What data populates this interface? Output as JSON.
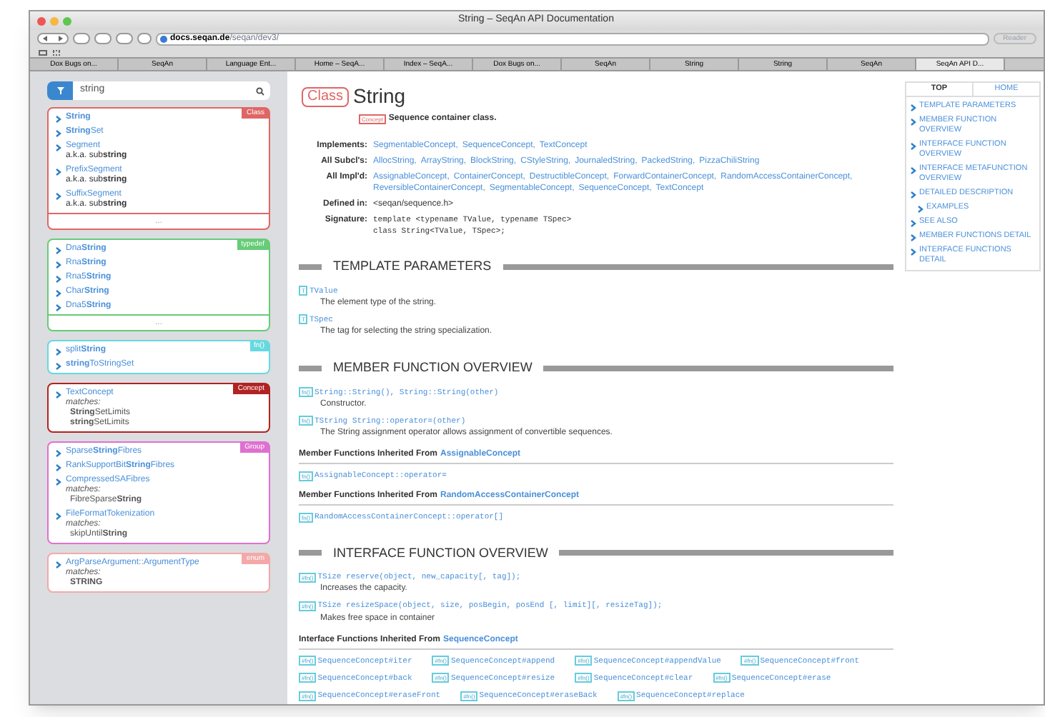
{
  "window": {
    "title": "String – SeqAn API Documentation"
  },
  "toolbar": {
    "url_host": "docs.seqan.de",
    "url_path": "/seqan/dev3/",
    "reader": "Reader"
  },
  "tabs": [
    {
      "label": "Dox Bugs on...",
      "selected": false
    },
    {
      "label": "SeqAn",
      "selected": false
    },
    {
      "label": "Language Ent...",
      "selected": false
    },
    {
      "label": "Home – SeqA...",
      "selected": false
    },
    {
      "label": "Index – SeqA...",
      "selected": false
    },
    {
      "label": "Dox Bugs on...",
      "selected": false
    },
    {
      "label": "SeqAn",
      "selected": false
    },
    {
      "label": "String",
      "selected": false
    },
    {
      "label": "String",
      "selected": false
    },
    {
      "label": "SeqAn",
      "selected": false
    },
    {
      "label": "SeqAn API D...",
      "selected": true
    }
  ],
  "sidebar": {
    "search": {
      "value": "string"
    },
    "groups": [
      {
        "tag": "Class",
        "color": "#e06666",
        "items": [
          {
            "name": "**String**"
          },
          {
            "name": "**String**Set"
          },
          {
            "name": "Segment",
            "details": [
              {
                "kind": "aka",
                "text": "a.k.a. sub**string**"
              }
            ]
          },
          {
            "name": "PrefixSegment",
            "details": [
              {
                "kind": "aka",
                "text": "a.k.a. sub**string**"
              }
            ]
          },
          {
            "name": "SuffixSegment",
            "details": [
              {
                "kind": "aka",
                "text": "a.k.a. sub**string**"
              }
            ]
          }
        ],
        "more": "..."
      },
      {
        "tag": "typedef",
        "color": "#66cc77",
        "items": [
          {
            "name": "Dna**String**"
          },
          {
            "name": "Rna**String**"
          },
          {
            "name": "Rna5**String**"
          },
          {
            "name": "Char**String**"
          },
          {
            "name": "Dna5**String**"
          }
        ],
        "more": "..."
      },
      {
        "tag": "fn()",
        "color": "#66d9e0",
        "items": [
          {
            "name": "split**String**"
          },
          {
            "name": "**string**ToStringSet"
          }
        ]
      },
      {
        "tag": "Concept",
        "color": "#b22222",
        "items": [
          {
            "name": "TextConcept",
            "details": [
              {
                "kind": "label",
                "text": "matches:"
              },
              {
                "kind": "match",
                "text": "**String**SetLimits"
              },
              {
                "kind": "match",
                "text": "**string**SetLimits"
              }
            ]
          }
        ]
      },
      {
        "tag": "Group",
        "color": "#e070d0",
        "items": [
          {
            "name": "Sparse**String**Fibres"
          },
          {
            "name": "RankSupportBit**String**Fibres"
          },
          {
            "name": "CompressedSAFibres",
            "details": [
              {
                "kind": "label",
                "text": "matches:"
              },
              {
                "kind": "match",
                "text": "FibreSparse**String**"
              }
            ]
          },
          {
            "name": "FileFormatTokenization",
            "details": [
              {
                "kind": "label",
                "text": "matches:"
              },
              {
                "kind": "match",
                "text": "skipUntil**String**"
              }
            ]
          }
        ]
      },
      {
        "tag": "enum",
        "color": "#f4a8a8",
        "items": [
          {
            "name": "ArgParseArgument::ArgumentType",
            "details": [
              {
                "kind": "label",
                "text": "matches:"
              },
              {
                "kind": "match",
                "text": "**STRING**"
              }
            ]
          }
        ]
      }
    ]
  },
  "main": {
    "kind_badge": "Class",
    "title": "String",
    "concept_badge": "Concept",
    "brief": "Sequence container class.",
    "info": [
      {
        "label": "Implements:",
        "kind": "links",
        "values": [
          "SegmentableConcept,",
          "SequenceConcept,",
          "TextConcept"
        ]
      },
      {
        "label": "All Subcl's:",
        "kind": "links",
        "values": [
          "AllocString,",
          "ArrayString,",
          "BlockString,",
          "CStyleString,",
          "JournaledString,",
          "PackedString,",
          "PizzaChiliString"
        ]
      },
      {
        "label": "All Impl'd:",
        "kind": "links",
        "values": [
          "AssignableConcept,",
          "ContainerConcept,",
          "DestructibleConcept,",
          "ForwardContainerConcept,",
          "RandomAccessContainerConcept,",
          "ReversibleContainerConcept,",
          "SegmentableConcept,",
          "SequenceConcept,",
          "TextConcept"
        ]
      },
      {
        "label": "Defined in:",
        "kind": "text",
        "values": [
          "<seqan/sequence.h>"
        ]
      },
      {
        "label": "Signature:",
        "kind": "code",
        "values": [
          "template <typename TValue, typename TSpec>",
          "class String<TValue, TSpec>;"
        ]
      }
    ],
    "sections": [
      {
        "title": "TEMPLATE PARAMETERS",
        "entries": [
          {
            "badge": "T",
            "name": "TValue",
            "desc": "The element type of the string."
          },
          {
            "badge": "T",
            "name": "TSpec",
            "desc": "The tag for selecting the string specialization."
          }
        ]
      },
      {
        "title": "MEMBER FUNCTION OVERVIEW",
        "entries": [
          {
            "badge": "fn()",
            "name": "String::String(), String::String(other)",
            "desc": "Constructor."
          },
          {
            "badge": "fn()",
            "name": "TString String::operator=(other)",
            "desc": "The String assignment operator allows assignment of convertible sequences."
          }
        ],
        "inherited": [
          {
            "label": "Member Functions Inherited From",
            "link": "AssignableConcept",
            "items": [
              {
                "badge": "fn()",
                "name": "AssignableConcept::operator="
              }
            ]
          },
          {
            "label": "Member Functions Inherited From",
            "link": "RandomAccessContainerConcept",
            "items": [
              {
                "badge": "fn()",
                "name": "RandomAccessContainerConcept::operator[]"
              }
            ]
          }
        ]
      },
      {
        "title": "INTERFACE FUNCTION OVERVIEW",
        "entries": [
          {
            "badge": "#fn()",
            "name": "TSize reserve(object, new_capacity[, tag]);",
            "desc": "Increases the capacity."
          },
          {
            "badge": "#fn()",
            "name": "TSize resizeSpace(object, size, posBegin, posEnd [, limit][, resizeTag]);",
            "desc": "Makes free space in container"
          }
        ],
        "inherited": [
          {
            "label": "Interface Functions Inherited From",
            "link": "SequenceConcept",
            "items": [
              {
                "badge": "#fn()",
                "name": "SequenceConcept#iter"
              },
              {
                "badge": "#fn()",
                "name": "SequenceConcept#append"
              },
              {
                "badge": "#fn()",
                "name": "SequenceConcept#appendValue"
              },
              {
                "badge": "#fn()",
                "name": "SequenceConcept#front"
              },
              {
                "badge": "#fn()",
                "name": "SequenceConcept#back"
              },
              {
                "badge": "#fn()",
                "name": "SequenceConcept#resize"
              },
              {
                "badge": "#fn()",
                "name": "SequenceConcept#clear"
              },
              {
                "badge": "#fn()",
                "name": "SequenceConcept#erase"
              },
              {
                "badge": "#fn()",
                "name": "SequenceConcept#eraseFront"
              },
              {
                "badge": "#fn()",
                "name": "SequenceConcept#eraseBack"
              },
              {
                "badge": "#fn()",
                "name": "SequenceConcept#replace"
              }
            ]
          }
        ]
      }
    ]
  },
  "toc": {
    "top": "TOP",
    "home": "HOME",
    "items": [
      {
        "label": "TEMPLATE PARAMETERS"
      },
      {
        "label": "MEMBER FUNCTION OVERVIEW"
      },
      {
        "label": "INTERFACE FUNCTION OVERVIEW"
      },
      {
        "label": "INTERFACE METAFUNCTION OVERVIEW"
      },
      {
        "label": "DETAILED DESCRIPTION",
        "children": [
          {
            "label": "EXAMPLES"
          }
        ]
      },
      {
        "label": "SEE ALSO"
      },
      {
        "label": "MEMBER FUNCTIONS DETAIL"
      },
      {
        "label": "INTERFACE FUNCTIONS DETAIL"
      }
    ]
  }
}
